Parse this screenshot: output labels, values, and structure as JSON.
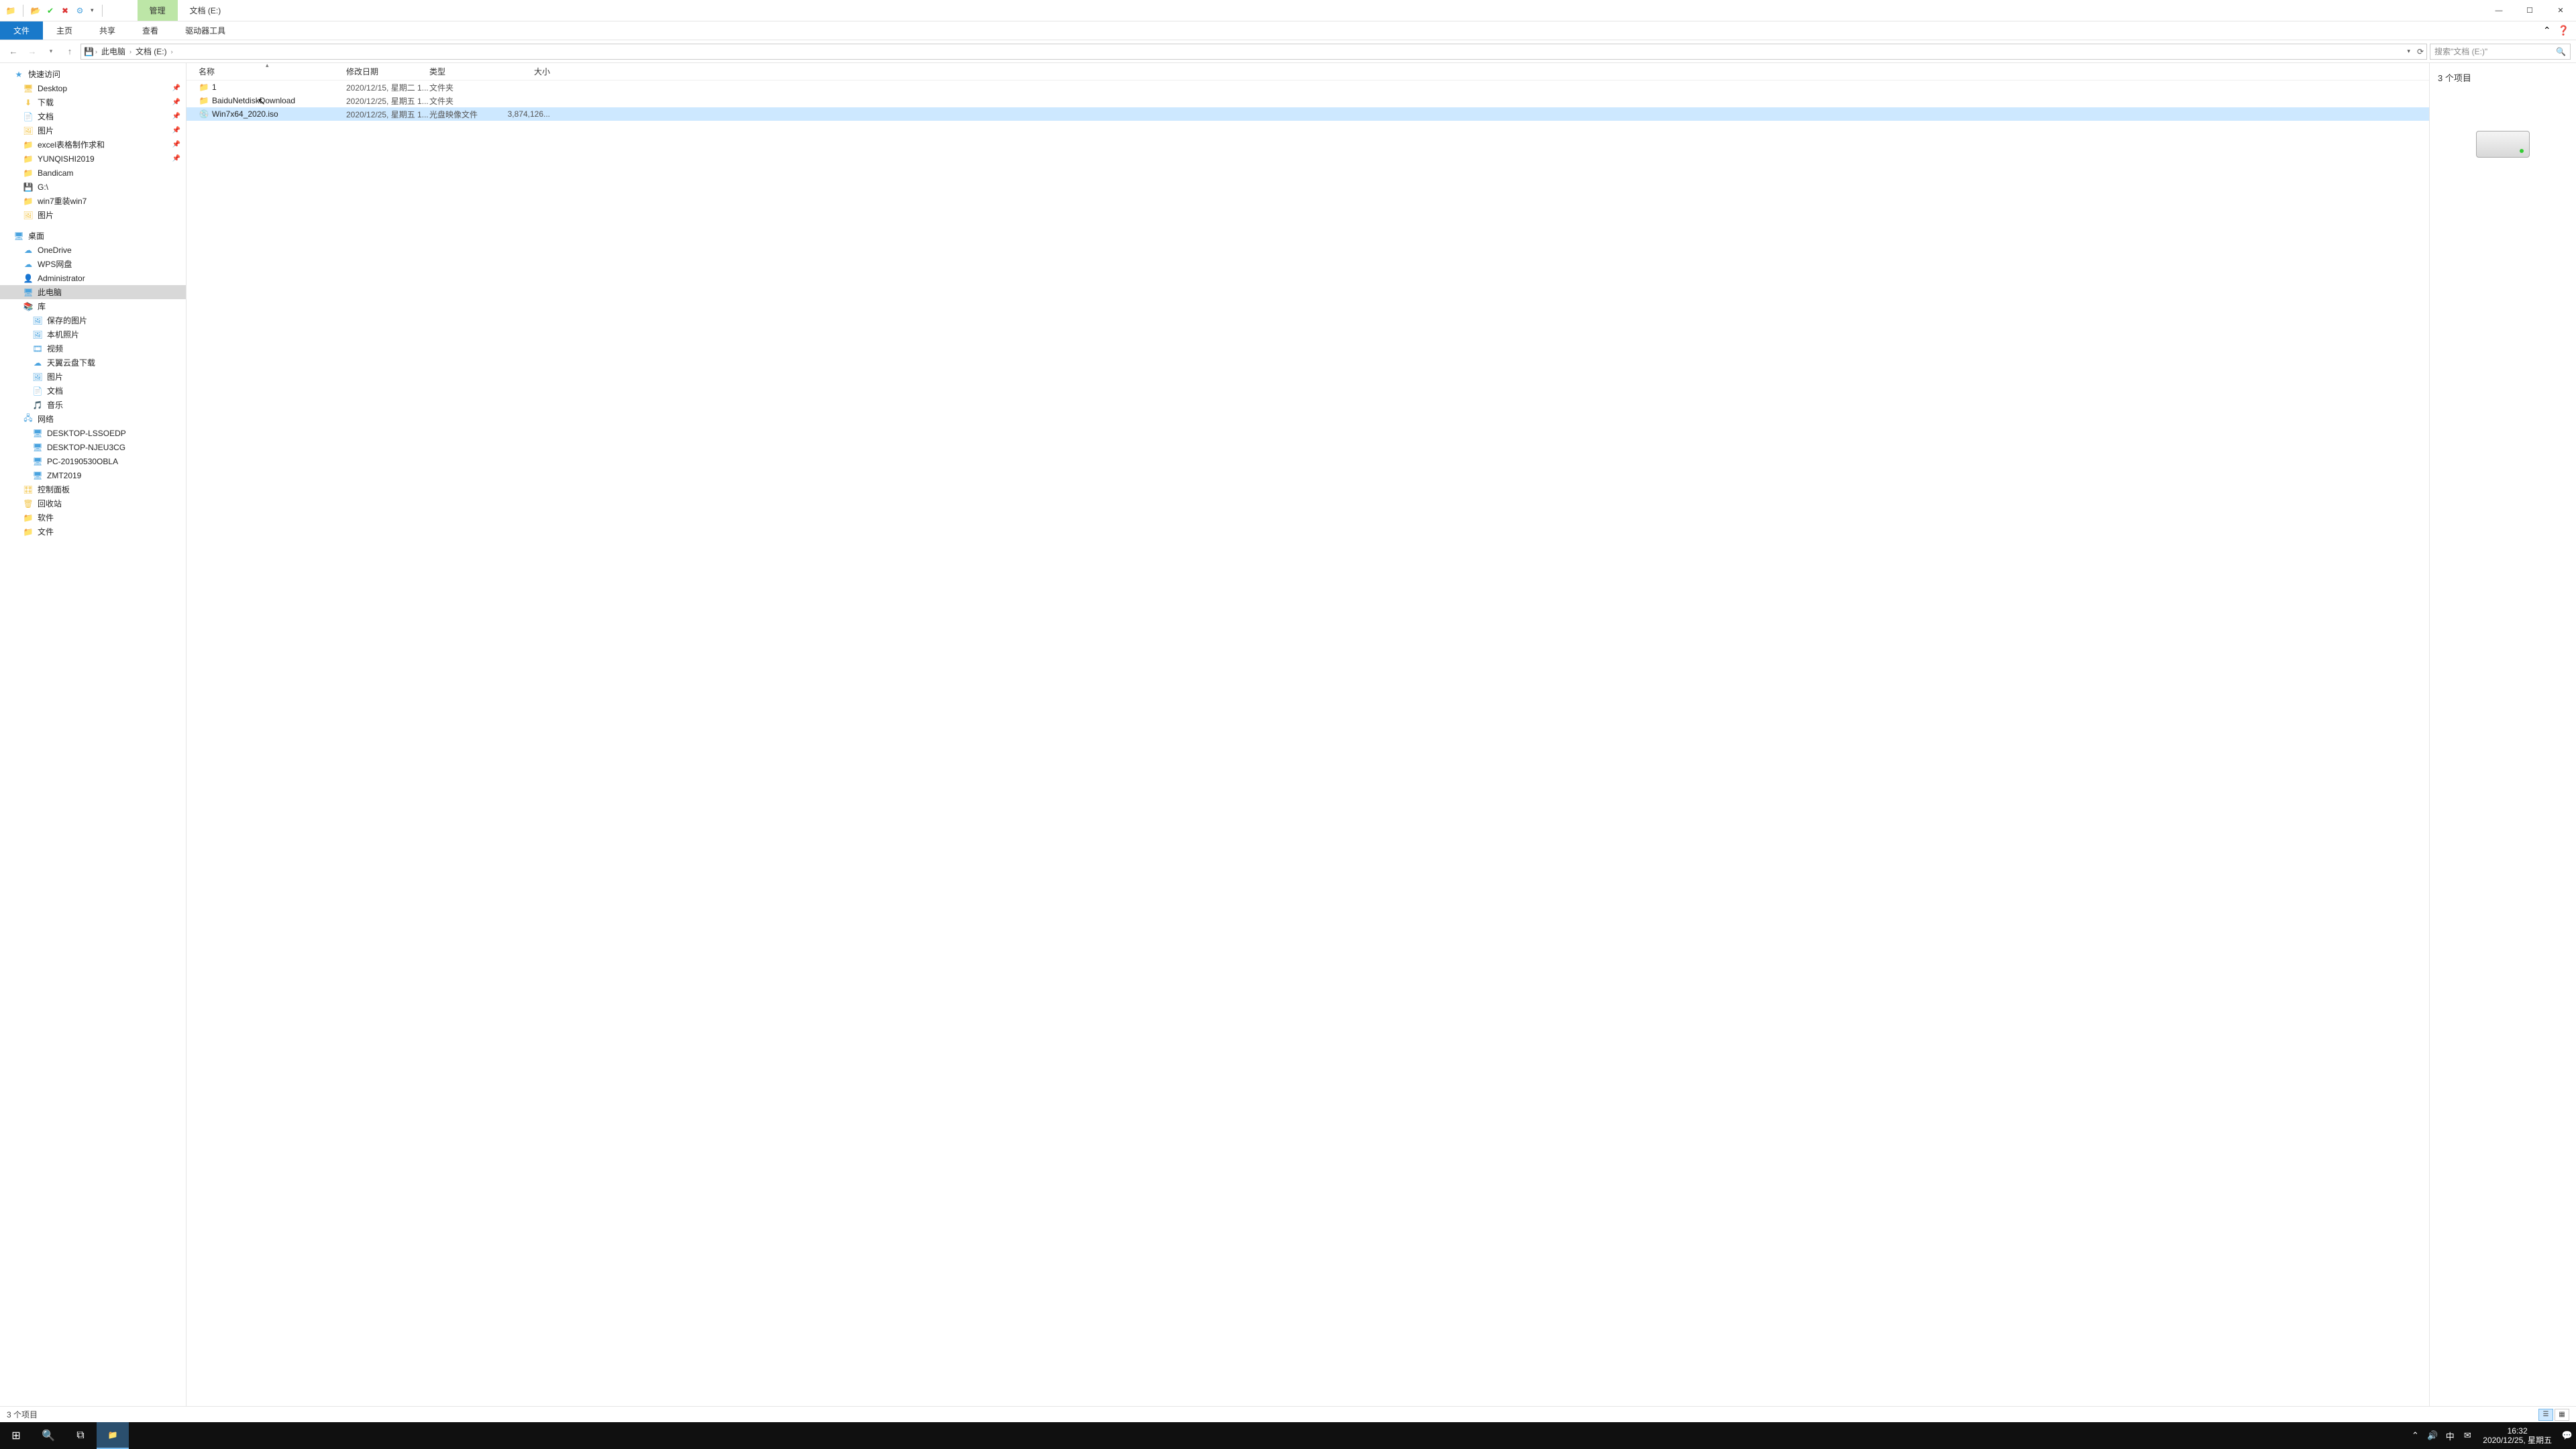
{
  "titlebar": {
    "context_tab": "管理",
    "window_title": "文档 (E:)"
  },
  "ribbon": {
    "file": "文件",
    "home": "主页",
    "share": "共享",
    "view": "查看",
    "drive_tools": "驱动器工具"
  },
  "address": {
    "crumbs": [
      "此电脑",
      "文档 (E:)"
    ],
    "search_placeholder": "搜索\"文档 (E:)\""
  },
  "navtree": {
    "quick_access": "快速访问",
    "quick_items": [
      {
        "icon": "🖥",
        "label": "Desktop",
        "pin": true
      },
      {
        "icon": "⬇",
        "label": "下载",
        "pin": true
      },
      {
        "icon": "📄",
        "label": "文档",
        "pin": true
      },
      {
        "icon": "🖼",
        "label": "图片",
        "pin": true
      },
      {
        "icon": "📁",
        "label": "excel表格制作求和",
        "pin": true
      },
      {
        "icon": "📁",
        "label": "YUNQISHI2019",
        "pin": true
      },
      {
        "icon": "📁",
        "label": "Bandicam",
        "pin": false
      },
      {
        "icon": "💾",
        "label": "G:\\",
        "pin": false
      },
      {
        "icon": "📁",
        "label": "win7重装win7",
        "pin": false
      },
      {
        "icon": "🖼",
        "label": "图片",
        "pin": false
      }
    ],
    "desktop": "桌面",
    "desktop_items": [
      {
        "icon": "☁",
        "label": "OneDrive",
        "cls": "ico-blue"
      },
      {
        "icon": "☁",
        "label": "WPS网盘",
        "cls": "ico-blue"
      },
      {
        "icon": "👤",
        "label": "Administrator",
        "cls": ""
      },
      {
        "icon": "🖥",
        "label": "此电脑",
        "cls": "ico-blue",
        "sel": true
      },
      {
        "icon": "📚",
        "label": "库",
        "cls": "ico-folder"
      }
    ],
    "library_items": [
      {
        "icon": "🖼",
        "label": "保存的图片"
      },
      {
        "icon": "🖼",
        "label": "本机照片"
      },
      {
        "icon": "🎞",
        "label": "视频"
      },
      {
        "icon": "☁",
        "label": "天翼云盘下载"
      },
      {
        "icon": "🖼",
        "label": "图片"
      },
      {
        "icon": "📄",
        "label": "文档"
      },
      {
        "icon": "🎵",
        "label": "音乐"
      }
    ],
    "network": "网络",
    "network_items": [
      {
        "label": "DESKTOP-LSSOEDP"
      },
      {
        "label": "DESKTOP-NJEU3CG"
      },
      {
        "label": "PC-20190530OBLA"
      },
      {
        "label": "ZMT2019"
      }
    ],
    "tail_items": [
      {
        "icon": "🎛",
        "label": "控制面板"
      },
      {
        "icon": "🗑",
        "label": "回收站"
      },
      {
        "icon": "📁",
        "label": "软件"
      },
      {
        "icon": "📁",
        "label": "文件"
      }
    ]
  },
  "columns": {
    "name": "名称",
    "date": "修改日期",
    "type": "类型",
    "size": "大小"
  },
  "files": [
    {
      "icon": "📁",
      "name": "1",
      "date": "2020/12/15, 星期二 1...",
      "type": "文件夹",
      "size": "",
      "cls": "ico-folder"
    },
    {
      "icon": "📁",
      "name": "BaiduNetdiskDownload",
      "date": "2020/12/25, 星期五 1...",
      "type": "文件夹",
      "size": "",
      "cls": "ico-folder"
    },
    {
      "icon": "💿",
      "name": "Win7x64_2020.iso",
      "date": "2020/12/25, 星期五 1...",
      "type": "光盘映像文件",
      "size": "3,874,126...",
      "cls": "ico-disc",
      "sel": true
    }
  ],
  "preview": {
    "title": "3 个项目"
  },
  "status": {
    "text": "3 个项目"
  },
  "tray": {
    "ime": "中",
    "time": "16:32",
    "date": "2020/12/25, 星期五"
  }
}
